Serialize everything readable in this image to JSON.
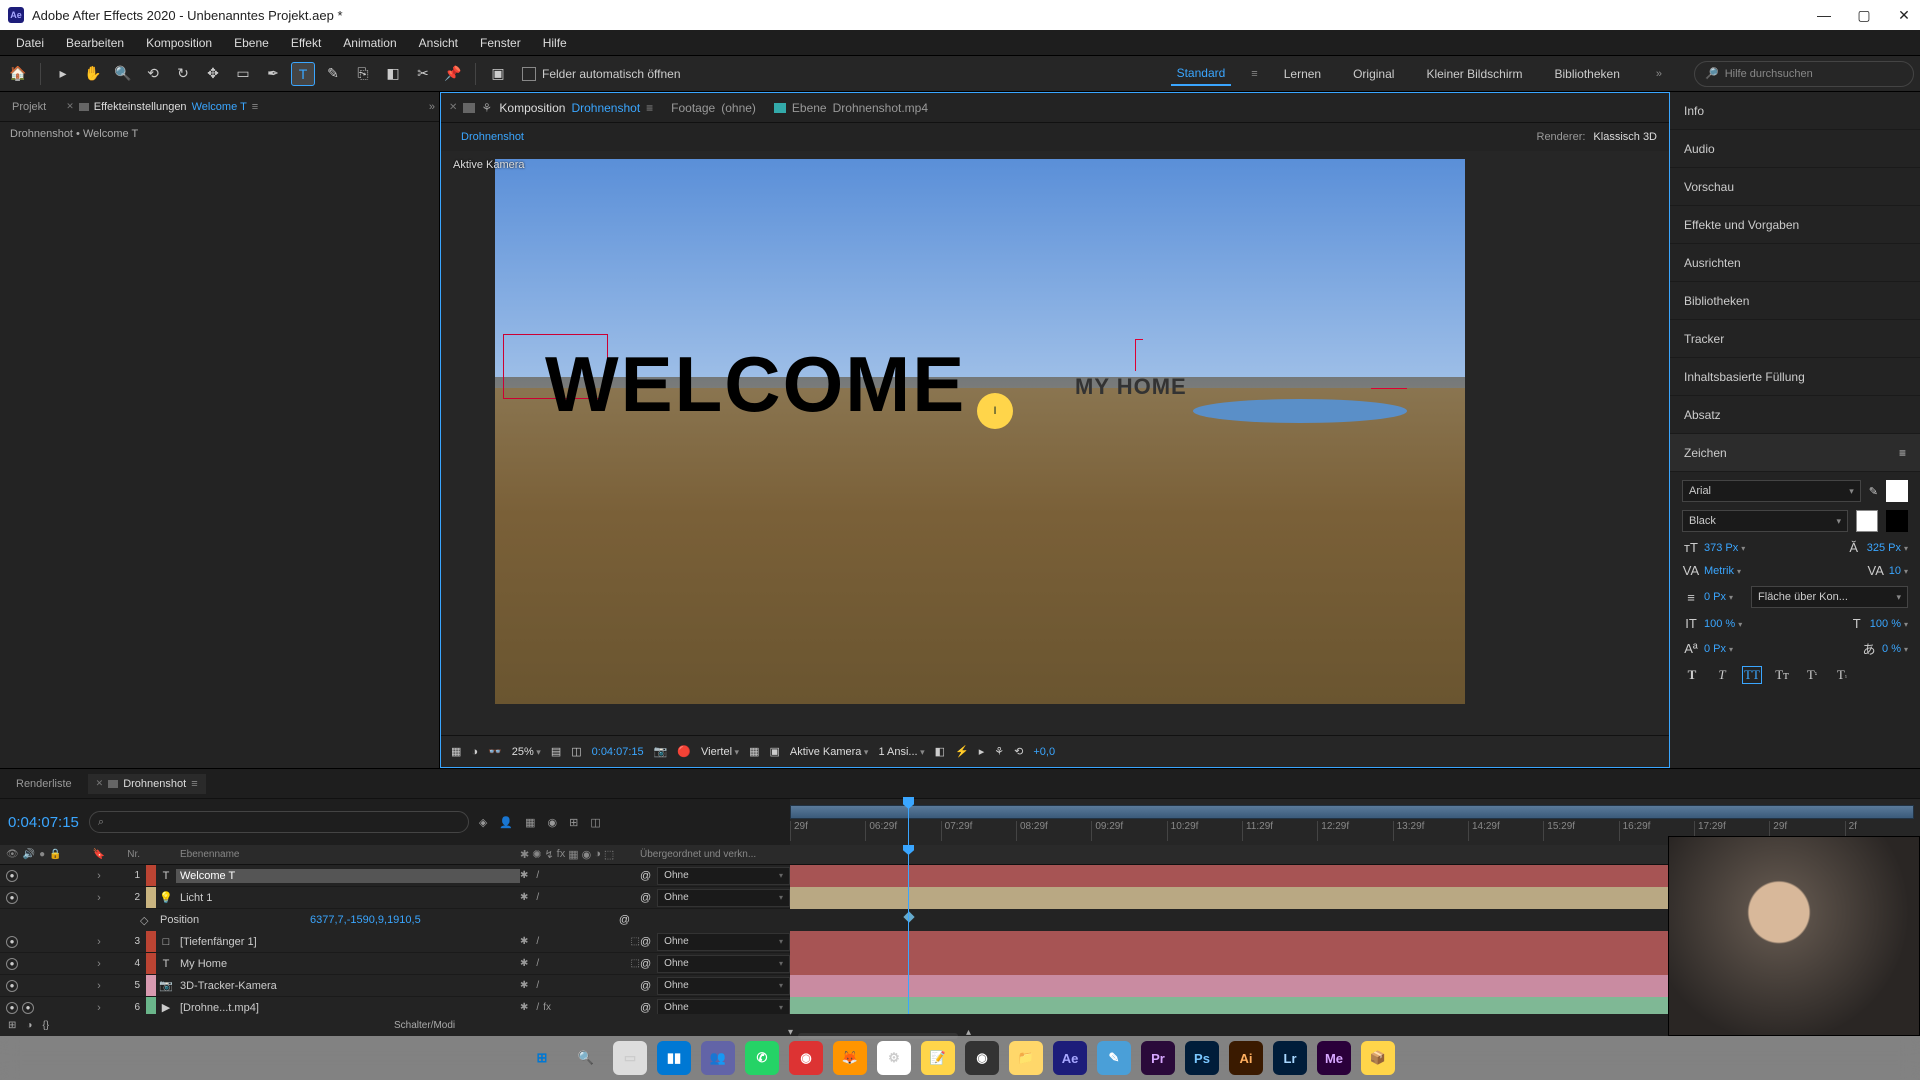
{
  "title": "Adobe After Effects 2020 - Unbenanntes Projekt.aep *",
  "menu": [
    "Datei",
    "Bearbeiten",
    "Komposition",
    "Ebene",
    "Effekt",
    "Animation",
    "Ansicht",
    "Fenster",
    "Hilfe"
  ],
  "toolbar": {
    "checkbox": "Felder automatisch öffnen",
    "workspaces": [
      "Standard",
      "Lernen",
      "Original",
      "Kleiner Bildschirm",
      "Bibliotheken"
    ],
    "search_placeholder": "Hilfe durchsuchen"
  },
  "left": {
    "tab1_prefix": "Projekt",
    "tab2_label": "Effekteinstellungen",
    "tab2_link": "Welcome T",
    "breadcrumb": "Drohnenshot • Welcome T"
  },
  "comp": {
    "tab_comp_label": "Komposition",
    "tab_comp_link": "Drohnenshot",
    "tab_footage_label": "Footage",
    "tab_footage_val": "(ohne)",
    "tab_layer_label": "Ebene",
    "tab_layer_val": "Drohnenshot.mp4",
    "chip": "Drohnenshot",
    "renderer_label": "Renderer:",
    "renderer_val": "Klassisch 3D",
    "viewport_label": "Aktive Kamera",
    "text_welcome": "WELCOME",
    "text_myhome": "MY HOME",
    "footer": {
      "zoom": "25%",
      "timecode": "0:04:07:15",
      "quality": "Viertel",
      "camera": "Aktive Kamera",
      "views": "1 Ansi...",
      "exposure": "+0,0"
    }
  },
  "right_panels": [
    "Info",
    "Audio",
    "Vorschau",
    "Effekte und Vorgaben",
    "Ausrichten",
    "Bibliotheken",
    "Tracker",
    "Inhaltsbasierte Füllung",
    "Absatz",
    "Zeichen"
  ],
  "character": {
    "font": "Arial",
    "style": "Black",
    "size": "373 Px",
    "leading": "325 Px",
    "kerning": "Metrik",
    "tracking": "10",
    "stroke_w": "0 Px",
    "stroke_mode": "Fläche über Kon...",
    "hscale": "100 %",
    "vscale": "100 %",
    "baseline": "0 Px",
    "tsume": "0 %"
  },
  "timeline": {
    "tab_render": "Renderliste",
    "tab_comp": "Drohnenshot",
    "timecode": "0:04:07:15",
    "col_nr": "Nr.",
    "col_name": "Ebenenname",
    "col_parent": "Übergeordnet und verkn...",
    "ruler": [
      "29f",
      "06:29f",
      "07:29f",
      "08:29f",
      "09:29f",
      "10:29f",
      "11:29f",
      "12:29f",
      "13:29f",
      "14:29f",
      "15:29f",
      "16:29f",
      "17:29f",
      "29f",
      "2f"
    ],
    "layers": [
      {
        "n": "1",
        "name": "Welcome T",
        "color": "#b43",
        "icon": "T",
        "sel": true,
        "parent": "Ohne",
        "cube": false
      },
      {
        "n": "2",
        "name": "Licht 1",
        "color": "#c9b480",
        "icon": "💡",
        "sel": false,
        "parent": "Ohne",
        "cube": false
      },
      {
        "n": "3",
        "name": "[Tiefenfänger 1]",
        "color": "#b43",
        "icon": "□",
        "sel": false,
        "parent": "Ohne",
        "cube": true
      },
      {
        "n": "4",
        "name": "My Home",
        "color": "#b43",
        "icon": "T",
        "sel": false,
        "parent": "Ohne",
        "cube": true
      },
      {
        "n": "5",
        "name": "3D-Tracker-Kamera",
        "color": "#d89ab0",
        "icon": "📷",
        "sel": false,
        "parent": "Ohne",
        "cube": false
      },
      {
        "n": "6",
        "name": "[Drohne...t.mp4]",
        "color": "#6ab58a",
        "icon": "▶",
        "sel": false,
        "parent": "Ohne",
        "cube": false
      }
    ],
    "prop_name": "Position",
    "prop_value": "6377,7,-1590,9,1910,5",
    "footer_label": "Schalter/Modi"
  }
}
